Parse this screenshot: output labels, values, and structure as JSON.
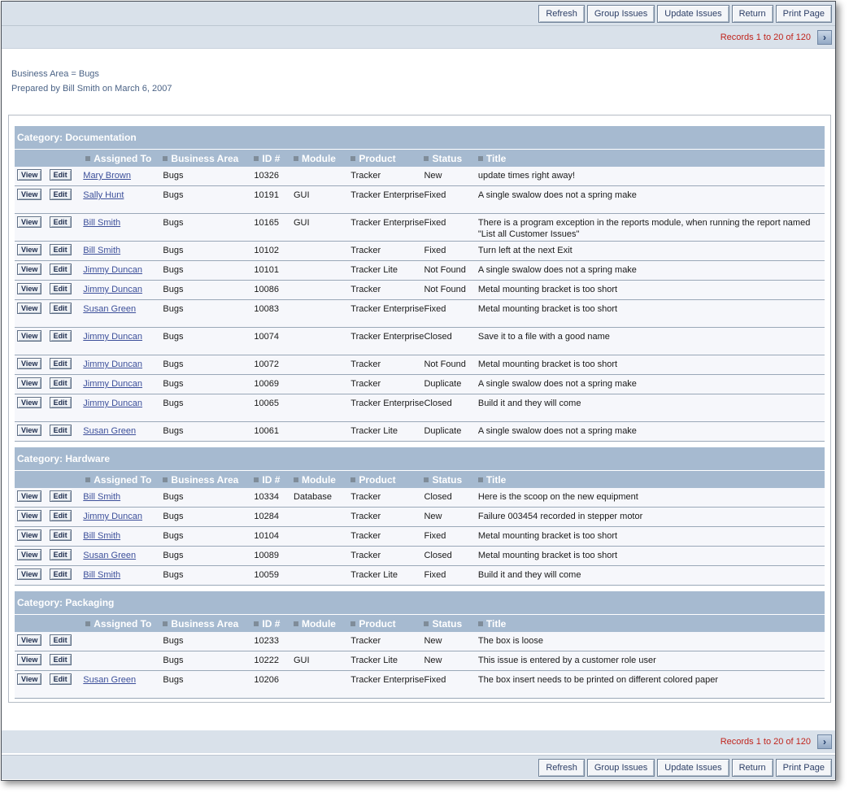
{
  "toolbar": {
    "buttons": [
      "Refresh",
      "Group Issues",
      "Update Issues",
      "Return",
      "Print Page"
    ]
  },
  "pager": {
    "text": "Records 1 to 20 of 120",
    "next_icon": "chevron-right-icon"
  },
  "info": {
    "filter": "Business Area = Bugs",
    "prepared": "Prepared by Bill Smith on March 6, 2007"
  },
  "columns": [
    "Assigned To",
    "Business Area",
    "ID #",
    "Module",
    "Product",
    "Status",
    "Title"
  ],
  "row_buttons": {
    "view": "View",
    "edit": "Edit"
  },
  "categories": [
    {
      "label": "Category: Documentation",
      "rows": [
        {
          "assigned": "Mary Brown",
          "area": "Bugs",
          "id": "10326",
          "module": "",
          "product": "Tracker",
          "status": "New",
          "title": "update times right away!"
        },
        {
          "assigned": "Sally Hunt",
          "area": "Bugs",
          "id": "10191",
          "module": "GUI",
          "product": "Tracker Enterprise",
          "status": "Fixed",
          "title": "A single swalow does not a spring make"
        },
        {
          "assigned": "Bill Smith",
          "area": "Bugs",
          "id": "10165",
          "module": "GUI",
          "product": "Tracker Enterprise",
          "status": "Fixed",
          "title": "There is a program exception in the reports module, when running the report named \"List all Customer Issues\""
        },
        {
          "assigned": "Bill Smith",
          "area": "Bugs",
          "id": "10102",
          "module": "",
          "product": "Tracker",
          "status": "Fixed",
          "title": "Turn left at the next Exit"
        },
        {
          "assigned": "Jimmy Duncan",
          "area": "Bugs",
          "id": "10101",
          "module": "",
          "product": "Tracker Lite",
          "status": "Not Found",
          "title": "A single swalow does not a spring make"
        },
        {
          "assigned": "Jimmy Duncan",
          "area": "Bugs",
          "id": "10086",
          "module": "",
          "product": "Tracker",
          "status": "Not Found",
          "title": "Metal mounting bracket is too short"
        },
        {
          "assigned": "Susan Green",
          "area": "Bugs",
          "id": "10083",
          "module": "",
          "product": "Tracker Enterprise",
          "status": "Fixed",
          "title": "Metal mounting bracket is too short"
        },
        {
          "assigned": "Jimmy Duncan",
          "area": "Bugs",
          "id": "10074",
          "module": "",
          "product": "Tracker Enterprise",
          "status": "Closed",
          "title": "Save it to a file with a good name"
        },
        {
          "assigned": "Jimmy Duncan",
          "area": "Bugs",
          "id": "10072",
          "module": "",
          "product": "Tracker",
          "status": "Not Found",
          "title": "Metal mounting bracket is too short"
        },
        {
          "assigned": "Jimmy Duncan",
          "area": "Bugs",
          "id": "10069",
          "module": "",
          "product": "Tracker",
          "status": "Duplicate",
          "title": "A single swalow does not a spring make"
        },
        {
          "assigned": "Jimmy Duncan",
          "area": "Bugs",
          "id": "10065",
          "module": "",
          "product": "Tracker Enterprise",
          "status": "Closed",
          "title": "Build it and they will come"
        },
        {
          "assigned": "Susan Green",
          "area": "Bugs",
          "id": "10061",
          "module": "",
          "product": "Tracker Lite",
          "status": "Duplicate",
          "title": "A single swalow does not a spring make"
        }
      ]
    },
    {
      "label": "Category: Hardware",
      "rows": [
        {
          "assigned": "Bill Smith",
          "area": "Bugs",
          "id": "10334",
          "module": "Database",
          "product": "Tracker",
          "status": "Closed",
          "title": "Here is the scoop on the new equipment"
        },
        {
          "assigned": "Jimmy Duncan",
          "area": "Bugs",
          "id": "10284",
          "module": "",
          "product": "Tracker",
          "status": "New",
          "title": "Failure 003454 recorded in stepper motor"
        },
        {
          "assigned": "Bill Smith",
          "area": "Bugs",
          "id": "10104",
          "module": "",
          "product": "Tracker",
          "status": "Fixed",
          "title": "Metal mounting bracket is too short"
        },
        {
          "assigned": "Susan Green",
          "area": "Bugs",
          "id": "10089",
          "module": "",
          "product": "Tracker",
          "status": "Closed",
          "title": "Metal mounting bracket is too short"
        },
        {
          "assigned": "Bill Smith",
          "area": "Bugs",
          "id": "10059",
          "module": "",
          "product": "Tracker Lite",
          "status": "Fixed",
          "title": "Build it and they will come"
        }
      ]
    },
    {
      "label": "Category: Packaging",
      "rows": [
        {
          "assigned": "",
          "area": "Bugs",
          "id": "10233",
          "module": "",
          "product": "Tracker",
          "status": "New",
          "title": "The box is loose"
        },
        {
          "assigned": "",
          "area": "Bugs",
          "id": "10222",
          "module": "GUI",
          "product": "Tracker Lite",
          "status": "New",
          "title": "This issue is entered by a customer role user"
        },
        {
          "assigned": "Susan Green",
          "area": "Bugs",
          "id": "10206",
          "module": "",
          "product": "Tracker Enterprise",
          "status": "Fixed",
          "title": "The box insert needs to be printed on different colored paper"
        }
      ]
    }
  ]
}
